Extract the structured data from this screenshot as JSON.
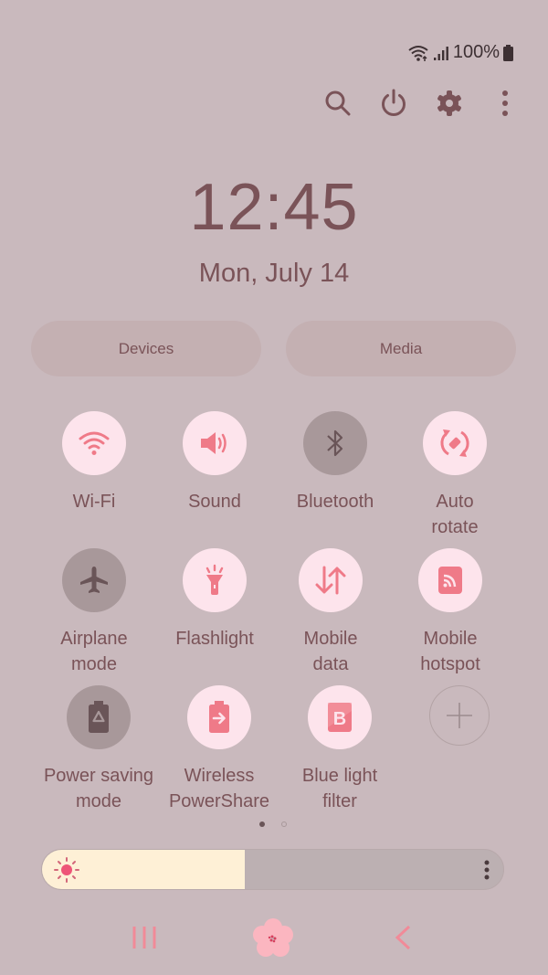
{
  "status_bar": {
    "battery": "100%",
    "icons": [
      "wifi-icon",
      "signal-icon",
      "battery-icon"
    ]
  },
  "toolbar": {
    "icons": [
      "search-icon",
      "power-icon",
      "settings-icon",
      "more-icon"
    ]
  },
  "clock": {
    "time": "12:45",
    "date": "Mon, July 14"
  },
  "pills": {
    "devices": "Devices",
    "media": "Media"
  },
  "tiles": [
    {
      "label": "Wi-Fi",
      "icon": "wifi-icon",
      "state": "on"
    },
    {
      "label": "Sound",
      "icon": "sound-icon",
      "state": "on"
    },
    {
      "label": "Bluetooth",
      "icon": "bluetooth-icon",
      "state": "off"
    },
    {
      "label": "Auto\nrotate",
      "icon": "auto-rotate-icon",
      "state": "on"
    },
    {
      "label": "Airplane\nmode",
      "icon": "airplane-icon",
      "state": "off"
    },
    {
      "label": "Flashlight",
      "icon": "flashlight-icon",
      "state": "on"
    },
    {
      "label": "Mobile\ndata",
      "icon": "mobile-data-icon",
      "state": "on"
    },
    {
      "label": "Mobile\nhotspot",
      "icon": "hotspot-icon",
      "state": "on"
    },
    {
      "label": "Power saving\nmode",
      "icon": "power-saving-icon",
      "state": "off"
    },
    {
      "label": "Wireless\nPowerShare",
      "icon": "powershare-icon",
      "state": "on"
    },
    {
      "label": "Blue light\nfilter",
      "icon": "blue-light-filter-icon",
      "state": "on"
    },
    {
      "label": "",
      "icon": "add-icon",
      "state": "add"
    }
  ],
  "pager": {
    "current": 1,
    "total": 2
  },
  "brightness": {
    "level": 0.44
  },
  "nav": {
    "icons": [
      "recents-icon",
      "home-icon",
      "back-icon"
    ]
  },
  "colors": {
    "background": "#c9b9bd",
    "accent": "#ef7a88",
    "tile_on": "#fde4ec",
    "tile_off": "#a8989a",
    "text": "#7a5358"
  }
}
